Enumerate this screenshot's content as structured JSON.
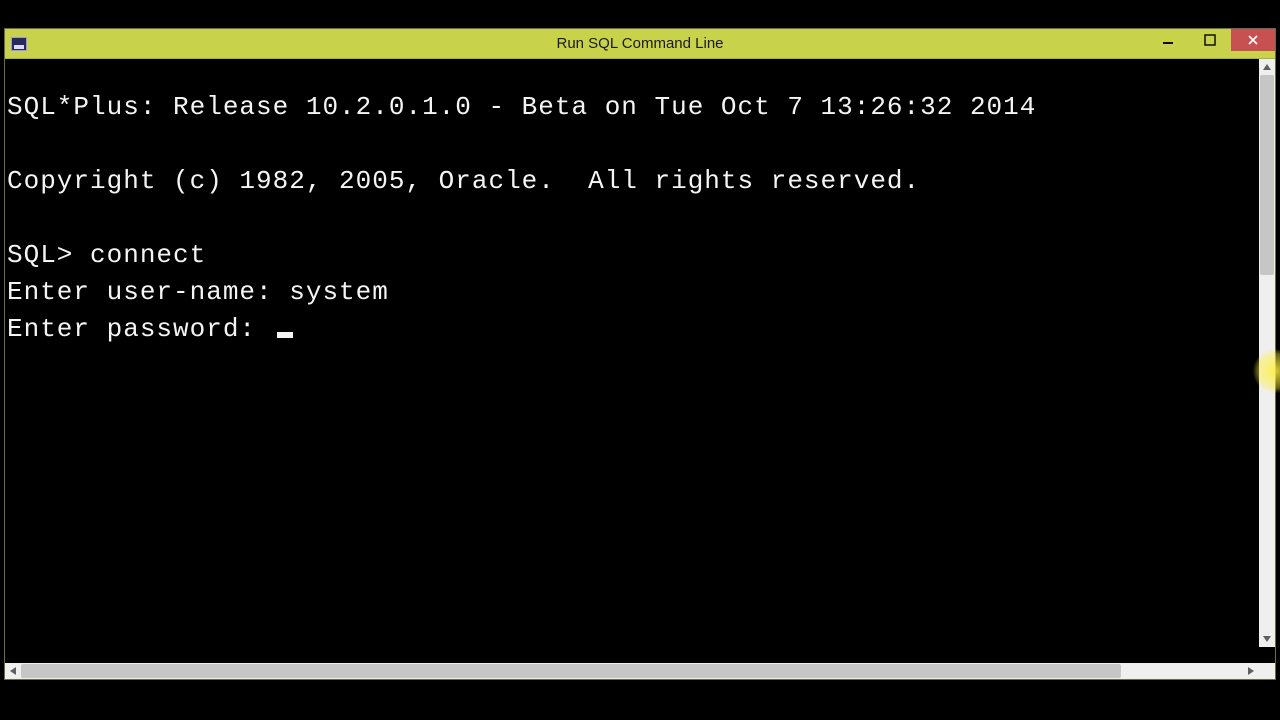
{
  "window": {
    "title": "Run SQL Command Line"
  },
  "terminal": {
    "line_banner": "SQL*Plus: Release 10.2.0.1.0 - Beta on Tue Oct 7 13:26:32 2014",
    "line_copyright": "Copyright (c) 1982, 2005, Oracle.  All rights reserved.",
    "prompt": "SQL> ",
    "command": "connect",
    "login_user_label": "Enter user-name: ",
    "login_user_value": "system",
    "login_pass_label": "Enter password: "
  }
}
